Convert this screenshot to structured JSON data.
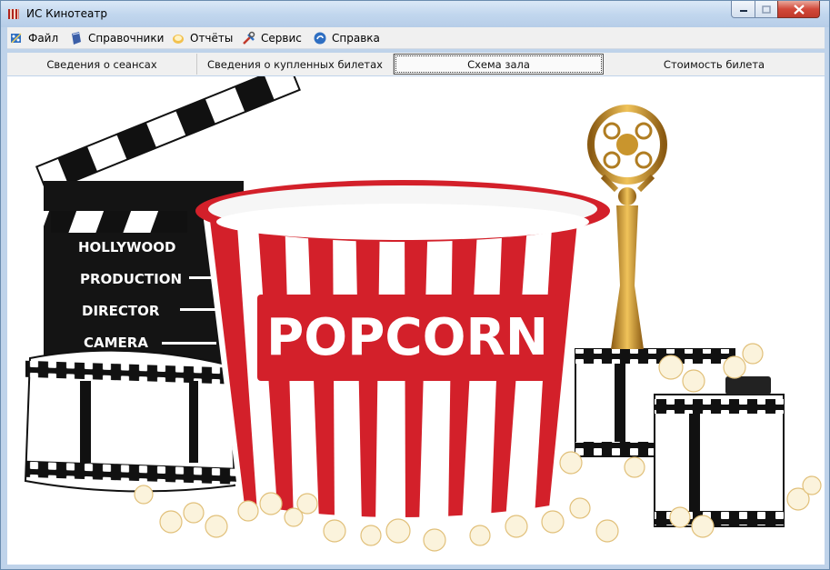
{
  "window": {
    "title": "ИС Кинотеатр",
    "icon": "clapper-app-icon"
  },
  "menu": [
    {
      "label": "Файл",
      "icon": "file-icon"
    },
    {
      "label": "Справочники",
      "icon": "book-icon"
    },
    {
      "label": "Отчёты",
      "icon": "report-icon"
    },
    {
      "label": "Сервис",
      "icon": "tools-icon"
    },
    {
      "label": "Справка",
      "icon": "help-icon"
    }
  ],
  "tabs": [
    {
      "label": "Сведения о сеансах",
      "active": false
    },
    {
      "label": "Сведения о купленных билетах",
      "active": false
    },
    {
      "label": "Схема зала",
      "active": true
    },
    {
      "label": "Стоимость билета",
      "active": false
    }
  ],
  "image": {
    "clapperboard_lines": [
      "HOLLYWOOD",
      "PRODUCTION",
      "DIRECTOR",
      "CAMERA"
    ],
    "bucket_text": "POPCORN",
    "colors": {
      "red": "#d3202a",
      "gold": "#c9952d",
      "black": "#111111"
    }
  }
}
